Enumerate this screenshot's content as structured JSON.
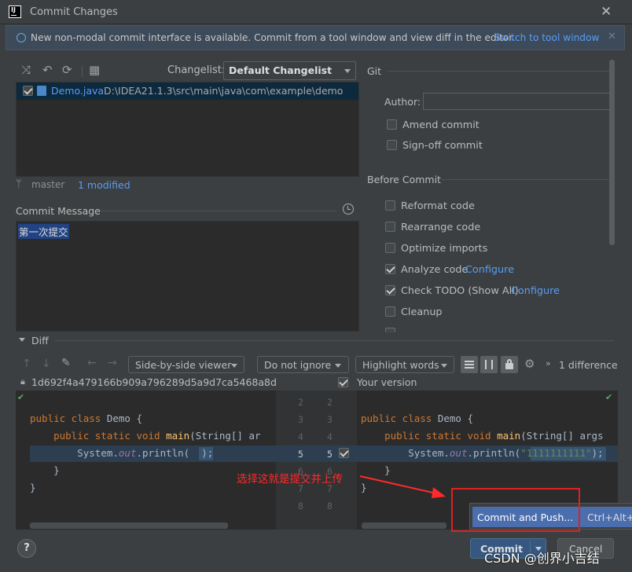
{
  "window": {
    "title": "Commit Changes",
    "close": "✕"
  },
  "banner": {
    "text": "New non-modal commit interface is available. Commit from a tool window and view diff in the editor.",
    "link": "Switch to tool window",
    "close": "✕"
  },
  "changelist": {
    "label": "Changelist:",
    "value": "Default Changelist"
  },
  "files": [
    {
      "name": "Demo.java",
      "path": "D:\\IDEA21.1.3\\src\\main\\java\\com\\example\\demo",
      "checked": true
    }
  ],
  "status": {
    "branch": "master",
    "modified": "1 modified"
  },
  "commit_message": {
    "label": "Commit Message",
    "text": "第一次提交"
  },
  "git": {
    "section": "Git",
    "author_label": "Author:",
    "author_value": "",
    "options": [
      {
        "label": "Amend commit",
        "checked": false
      },
      {
        "label": "Sign-off commit",
        "checked": false
      }
    ]
  },
  "before_commit": {
    "section": "Before Commit",
    "options": [
      {
        "label": "Reformat code",
        "checked": false,
        "link": ""
      },
      {
        "label": "Rearrange code",
        "checked": false,
        "link": ""
      },
      {
        "label": "Optimize imports",
        "checked": false,
        "link": ""
      },
      {
        "label": "Analyze code",
        "checked": true,
        "link": "Configure"
      },
      {
        "label": "Check TODO (Show All)",
        "checked": true,
        "link": "Configure"
      },
      {
        "label": "Cleanup",
        "checked": false,
        "link": ""
      }
    ]
  },
  "diff": {
    "label": "Diff",
    "viewer": "Side-by-side viewer",
    "ignore": "Do not ignore",
    "highlight": "Highlight words",
    "count": "1 difference",
    "left_hash": "1d692f4a479166b909a796289d5a9d7ca5468a8d",
    "right_title": "Your version",
    "left_code": [
      {
        "ln": "2",
        "text": ""
      },
      {
        "ln": "3",
        "text": "public class Demo {"
      },
      {
        "ln": "4",
        "text": "    public static void main(String[] ar"
      },
      {
        "ln": "5",
        "text": "        System.out.println(  );"
      },
      {
        "ln": "6",
        "text": "    }"
      },
      {
        "ln": "7",
        "text": "}"
      },
      {
        "ln": "8",
        "text": ""
      }
    ],
    "right_code": [
      {
        "ln": "2",
        "text": ""
      },
      {
        "ln": "3",
        "text": "public class Demo {"
      },
      {
        "ln": "4",
        "text": "    public static void main(String[] args"
      },
      {
        "ln": "5",
        "text": "        System.out.println(\"1111111111\");"
      },
      {
        "ln": "6",
        "text": "    }"
      },
      {
        "ln": "7",
        "text": "}"
      },
      {
        "ln": "8",
        "text": ""
      }
    ]
  },
  "popup": {
    "item": "Commit and Push...",
    "shortcut": "Ctrl+Alt+K"
  },
  "annotation": "选择这就是提交并上传",
  "buttons": {
    "commit": "Commit",
    "cancel": "Cancel",
    "help": "?"
  },
  "watermark": "CSDN @创界小吉结",
  "colors": {
    "accent": "#589df6",
    "selection": "#0d293e",
    "primary_button": "#365880",
    "annotation": "#ff2a2a"
  }
}
